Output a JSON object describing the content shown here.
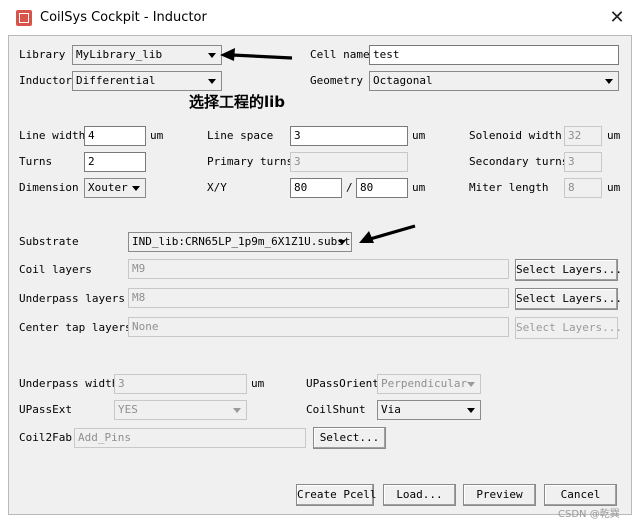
{
  "window": {
    "title": "CoilSys Cockpit - Inductor",
    "close_glyph": "✕"
  },
  "library": {
    "label": "Library",
    "value": "MyLibrary_lib"
  },
  "cell_name": {
    "label": "Cell name",
    "value": "test"
  },
  "inductor": {
    "label": "Inductor",
    "value": "Differential"
  },
  "geometry": {
    "label": "Geometry",
    "value": "Octagonal"
  },
  "annotation": {
    "text": "选择工程的lib",
    "arrow_color": "#000000"
  },
  "line_width": {
    "label": "Line width",
    "value": "4",
    "unit": "um"
  },
  "line_space": {
    "label": "Line space",
    "value": "3",
    "unit": "um"
  },
  "solenoid_width": {
    "label": "Solenoid width",
    "value": "32",
    "unit": "um"
  },
  "turns": {
    "label": "Turns",
    "value": "2"
  },
  "primary_turns": {
    "label": "Primary turns",
    "value": "3"
  },
  "secondary_turns": {
    "label": "Secondary turns",
    "value": "3"
  },
  "dimension": {
    "label": "Dimension",
    "value": "Xouter"
  },
  "xy": {
    "label": "X/Y",
    "x": "80",
    "sep": "/",
    "y": "80",
    "unit": "um"
  },
  "miter_length": {
    "label": "Miter length",
    "value": "8",
    "unit": "um"
  },
  "substrate": {
    "label": "Substrate",
    "value": "IND_lib:CRN65LP_1p9m_6X1Z1U.subst"
  },
  "coil_layers": {
    "label": "Coil layers",
    "value": "M9",
    "button": "Select Layers..."
  },
  "underpass_layers": {
    "label": "Underpass layers",
    "value": "M8",
    "button": "Select Layers..."
  },
  "center_tap_layers": {
    "label": "Center tap layers",
    "value": "None",
    "button": "Select Layers..."
  },
  "underpass_width": {
    "label": "Underpass width",
    "value": "3",
    "unit": "um"
  },
  "upass_orient": {
    "label": "UPassOrient",
    "value": "Perpendicular"
  },
  "upass_ext": {
    "label": "UPassExt",
    "value": "YES"
  },
  "coil_shunt": {
    "label": "CoilShunt",
    "value": "Via"
  },
  "coil2fab": {
    "label": "Coil2Fab",
    "value": "Add_Pins",
    "button": "Select..."
  },
  "footer": {
    "create": "Create Pcell",
    "load": "Load...",
    "preview": "Preview",
    "cancel": "Cancel"
  },
  "watermark": "CSDN @乾巽"
}
